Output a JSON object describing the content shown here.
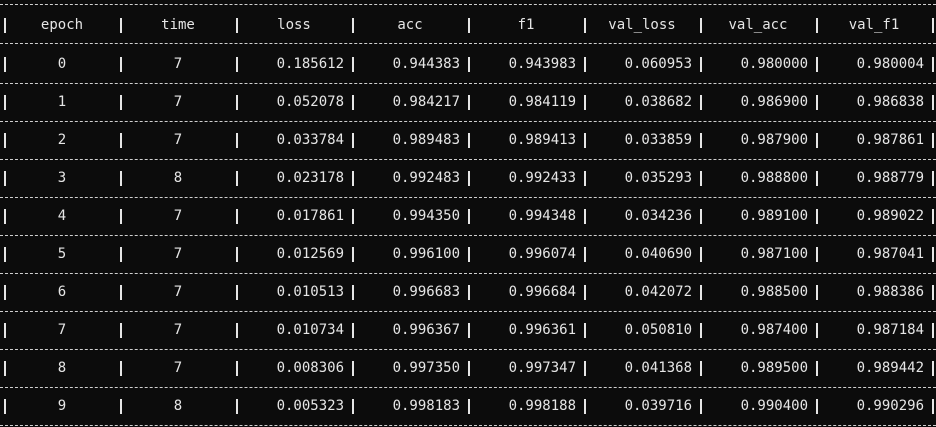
{
  "table": {
    "columns": [
      "epoch",
      "time",
      "loss",
      "acc",
      "f1",
      "val_loss",
      "val_acc",
      "val_f1"
    ],
    "rows": [
      [
        "0",
        "7",
        "0.185612",
        "0.944383",
        "0.943983",
        "0.060953",
        "0.980000",
        "0.980004"
      ],
      [
        "1",
        "7",
        "0.052078",
        "0.984217",
        "0.984119",
        "0.038682",
        "0.986900",
        "0.986838"
      ],
      [
        "2",
        "7",
        "0.033784",
        "0.989483",
        "0.989413",
        "0.033859",
        "0.987900",
        "0.987861"
      ],
      [
        "3",
        "8",
        "0.023178",
        "0.992483",
        "0.992433",
        "0.035293",
        "0.988800",
        "0.988779"
      ],
      [
        "4",
        "7",
        "0.017861",
        "0.994350",
        "0.994348",
        "0.034236",
        "0.989100",
        "0.989022"
      ],
      [
        "5",
        "7",
        "0.012569",
        "0.996100",
        "0.996074",
        "0.040690",
        "0.987100",
        "0.987041"
      ],
      [
        "6",
        "7",
        "0.010513",
        "0.996683",
        "0.996684",
        "0.042072",
        "0.988500",
        "0.988386"
      ],
      [
        "7",
        "7",
        "0.010734",
        "0.996367",
        "0.996361",
        "0.050810",
        "0.987400",
        "0.987184"
      ],
      [
        "8",
        "7",
        "0.008306",
        "0.997350",
        "0.997347",
        "0.041368",
        "0.989500",
        "0.989442"
      ],
      [
        "9",
        "8",
        "0.005323",
        "0.998183",
        "0.998188",
        "0.039716",
        "0.990400",
        "0.990296"
      ]
    ]
  }
}
